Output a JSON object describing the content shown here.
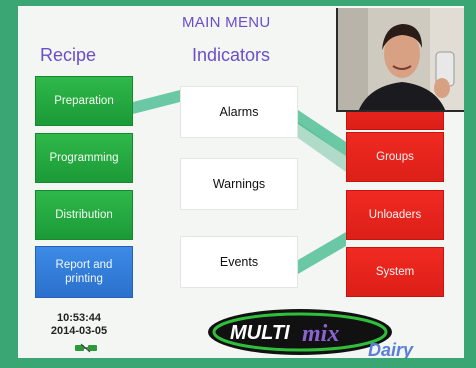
{
  "header": {
    "title": "MAIN MENU"
  },
  "recipe": {
    "title": "Recipe",
    "items": [
      {
        "label": "Preparation"
      },
      {
        "label": "Programming"
      },
      {
        "label": "Distribution"
      },
      {
        "label": "Report and printing"
      }
    ]
  },
  "indicators": {
    "title": "Indicators",
    "items": [
      {
        "label": "Alarms"
      },
      {
        "label": "Warnings"
      },
      {
        "label": "Events"
      }
    ]
  },
  "right_menu": {
    "items": [
      {
        "label": "Groups"
      },
      {
        "label": "Unloaders"
      },
      {
        "label": "System"
      }
    ]
  },
  "status": {
    "time": "10:53:44",
    "date": "2014-03-05"
  },
  "logo": {
    "text_main": "MULTI",
    "text_script": "mix",
    "text_brand": "Dairy"
  },
  "colors": {
    "recipe_green": "#22a83f",
    "report_blue": "#3580dc",
    "right_red": "#e6231c",
    "title_purple": "#6b4fc7",
    "frame_green": "#3aa673"
  },
  "icons": {
    "connection": "network-plug-icon"
  },
  "webcam": {
    "description_visible": false
  }
}
